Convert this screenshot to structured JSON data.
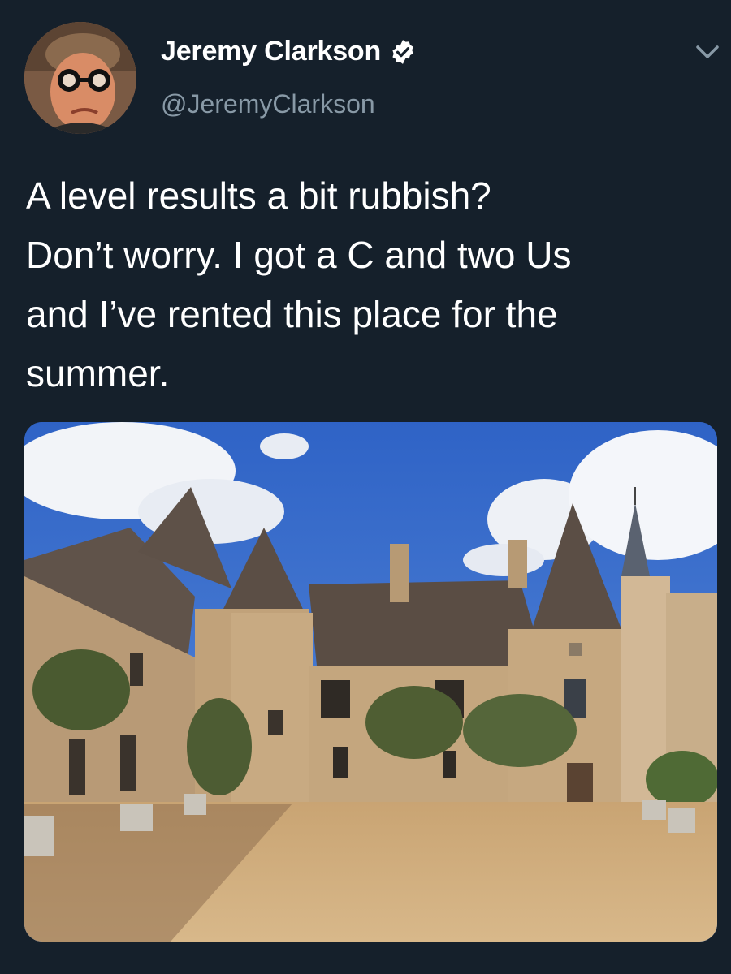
{
  "author": {
    "display_name": "Jeremy Clarkson",
    "handle": "@JeremyClarkson",
    "verified_icon": "verified-badge-icon",
    "avatar_icon": "profile-photo"
  },
  "tweet": {
    "text": "A level results a bit rubbish?\nDon’t worry. I got a C and two Us\nand I’ve rented this place for the\nsummer."
  },
  "menu": {
    "icon": "chevron-down-icon"
  },
  "media": {
    "subject": "chateau-courtyard-photo"
  },
  "colors": {
    "background": "#15202b",
    "text_primary": "#ffffff",
    "text_secondary": "#8899a6",
    "verified": "#ffffff"
  }
}
